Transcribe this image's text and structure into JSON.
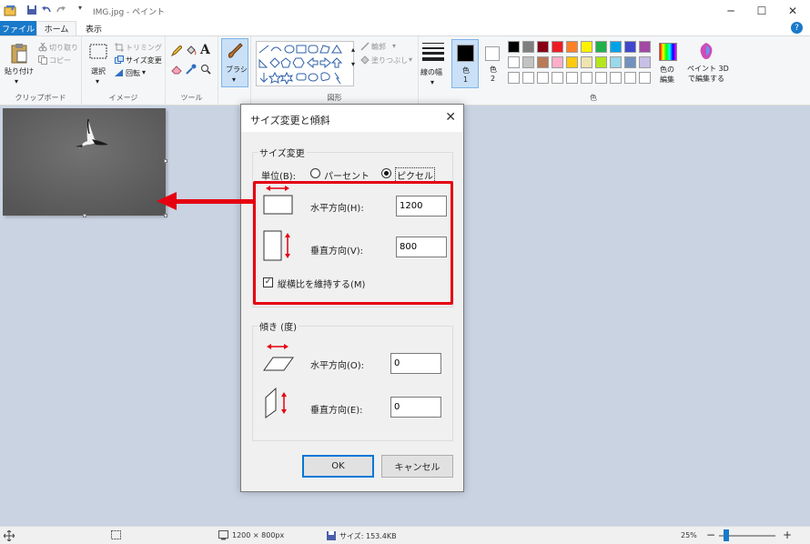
{
  "titlebar": {
    "title": "IMG.jpg - ペイント",
    "minimize": "─",
    "maximize": "☐",
    "close": "✕"
  },
  "tabs": {
    "file": "ファイル",
    "home": "ホーム",
    "view": "表示",
    "help": "?"
  },
  "ribbon": {
    "clipboard": {
      "paste": "貼り付け",
      "cut": "切り取り",
      "copy": "コピー",
      "label": "クリップボード"
    },
    "image": {
      "select": "選択",
      "crop": "トリミング",
      "resize": "サイズ変更",
      "rotate": "回転",
      "label": "イメージ"
    },
    "tools": {
      "label": "ツール"
    },
    "brush": {
      "label": "ブラシ"
    },
    "shapes": {
      "outline": "輪郭",
      "fill": "塗りつぶし",
      "label": "図形"
    },
    "line_width": "線の幅",
    "color1": {
      "line1": "色",
      "line2": "1"
    },
    "color2": {
      "line1": "色",
      "line2": "2"
    },
    "edit_colors": {
      "line1": "色の",
      "line2": "編集"
    },
    "paint3d": {
      "line1": "ペイント 3D",
      "line2": "で編集する"
    },
    "colors_label": "色",
    "palette_row1": [
      "#000000",
      "#7f7f7f",
      "#880015",
      "#ed1c24",
      "#ff7f27",
      "#fff200",
      "#22b14c",
      "#00a2e8",
      "#3f48cc",
      "#a349a4"
    ],
    "palette_row2": [
      "#ffffff",
      "#c3c3c3",
      "#b97a57",
      "#ffaec9",
      "#ffc90e",
      "#efe4b0",
      "#b5e61d",
      "#99d9ea",
      "#7092be",
      "#c8bfe7"
    ]
  },
  "dialog": {
    "title": "サイズ変更と傾斜",
    "close": "✕",
    "resize_group": "サイズ変更",
    "unit_label": "単位(B):",
    "percent": "パーセント",
    "pixel": "ピクセル",
    "horizontal_label": "水平方向(H):",
    "horizontal_value": "1200",
    "vertical_label": "垂直方向(V):",
    "vertical_value": "800",
    "keep_ratio": "縦横比を維持する(M)",
    "keep_ratio_checked": true,
    "skew_group": "傾き (度)",
    "skew_h_label": "水平方向(O):",
    "skew_h_value": "0",
    "skew_v_label": "垂直方向(E):",
    "skew_v_value": "0",
    "ok": "OK",
    "cancel": "キャンセル"
  },
  "statusbar": {
    "dimensions": "1200 × 800px",
    "size": "サイズ: 153.4KB",
    "zoom": "25%",
    "zoom_minus": "−",
    "zoom_plus": "+"
  },
  "annotation_color": "#e60012"
}
